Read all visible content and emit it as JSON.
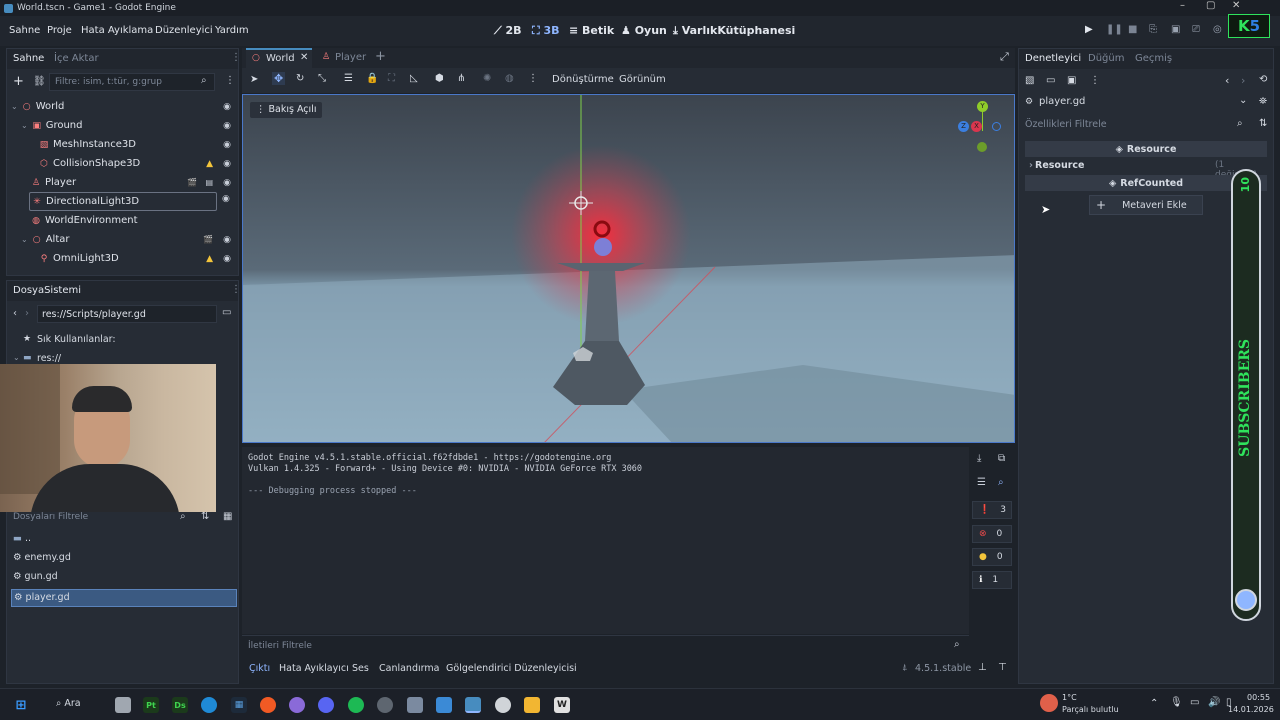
{
  "window": {
    "title": "World.tscn - Game1 - Godot Engine"
  },
  "menu": {
    "items": [
      "Sahne",
      "Proje",
      "Hata Ayıklama",
      "Düzenleyici",
      "Yardım"
    ]
  },
  "main_screens": {
    "b2d": "2B",
    "b3d": "3B",
    "script": "Betik",
    "game": "Oyun",
    "assetlib": "VarlıkKütüphanesi"
  },
  "scene_dock": {
    "tab_scene": "Sahne",
    "tab_import": "İçe Aktar",
    "filter_placeholder": "Filtre: isim, t:tür, g:grup",
    "nodes": [
      {
        "label": "World"
      },
      {
        "label": "Ground"
      },
      {
        "label": "MeshInstance3D"
      },
      {
        "label": "CollisionShape3D"
      },
      {
        "label": "Player"
      },
      {
        "label": "DirectionalLight3D"
      },
      {
        "label": "WorldEnvironment"
      },
      {
        "label": "Altar"
      },
      {
        "label": "OmniLight3D"
      }
    ]
  },
  "filesystem": {
    "title": "DosyaSistemi",
    "path": "res://Scripts/player.gd",
    "favorites": "Sık Kullanılanlar:",
    "root": "res://",
    "filter_placeholder": "Dosyaları Filtrele",
    "files": [
      {
        "name": ".."
      },
      {
        "name": "enemy.gd"
      },
      {
        "name": "gun.gd"
      },
      {
        "name": "player.gd"
      }
    ]
  },
  "editor_tabs": {
    "world": "World",
    "player": "Player"
  },
  "viewport_toolbar": {
    "transform": "Dönüştürme",
    "view": "Görünüm",
    "perspective": "Bakış Açılı"
  },
  "gizmo": {
    "y": "Y",
    "x": "X",
    "z": "Z"
  },
  "output": {
    "lines": [
      "Godot Engine v4.5.1.stable.official.f62fdbde1 - https://godotengine.org",
      "Vulkan 1.4.325 - Forward+ - Using Device #0: NVIDIA - NVIDIA GeForce RTX 3060",
      "",
      "--- Debugging process stopped ---"
    ],
    "filter_placeholder": "İletileri Filtrele",
    "counts": {
      "all": "3",
      "errors": "0",
      "warnings": "0",
      "info": "1"
    }
  },
  "bottom_tabs": {
    "output": "Çıktı",
    "debugger": "Hata Ayıklayıcı",
    "audio": "Ses",
    "animation": "Canlandırma",
    "shader": "Gölgelendirici Düzenleyicisi",
    "version": "4.5.1.stable"
  },
  "inspector": {
    "tab_inspector": "Denetleyici",
    "tab_node": "Düğüm",
    "tab_history": "Geçmiş",
    "object": "player.gd",
    "filter_placeholder": "Özellikleri Filtrele",
    "section_resource": "Resource",
    "resource_group": "Resource",
    "changes": "(1 değişme)",
    "section_refcounted": "RefCounted",
    "add_metadata": "Metaveri Ekle"
  },
  "overlay": {
    "subscribers": "SUBSCRIBERS",
    "count": "10",
    "badge": "5"
  },
  "taskbar": {
    "search": "Ara",
    "weather_temp": "1°C",
    "weather_desc": "Parçalı bulutlu",
    "time": "00:55",
    "date": "14.01.2026"
  }
}
